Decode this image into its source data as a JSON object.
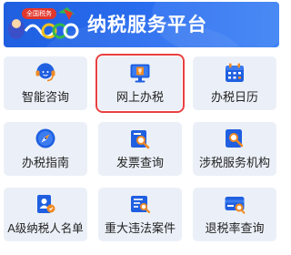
{
  "banner": {
    "title": "纳税服务平台",
    "logo_tag": "全国税务",
    "colors": {
      "bg": "#2a6ef0",
      "text": "#ffffff"
    }
  },
  "tiles": [
    {
      "label": "智能咨询",
      "icon": "customer-service-headset-icon"
    },
    {
      "label": "网上办税",
      "icon": "online-tax-monitor-icon",
      "selected": true
    },
    {
      "label": "办税日历",
      "icon": "calendar-icon"
    },
    {
      "label": "办税指南",
      "icon": "compass-icon"
    },
    {
      "label": "发票查询",
      "icon": "invoice-search-icon"
    },
    {
      "label": "涉税服务机构",
      "icon": "agency-search-icon"
    },
    {
      "label": "A级纳税人名单",
      "icon": "a-grade-list-icon"
    },
    {
      "label": "重大违法案件",
      "icon": "case-search-icon"
    },
    {
      "label": "退税率查询",
      "icon": "rate-card-icon"
    }
  ],
  "colors": {
    "tile_bg": "#ebf0f8",
    "icon_primary": "#1f5fe0",
    "icon_accent": "#f08a24",
    "selection": "#e84040"
  }
}
